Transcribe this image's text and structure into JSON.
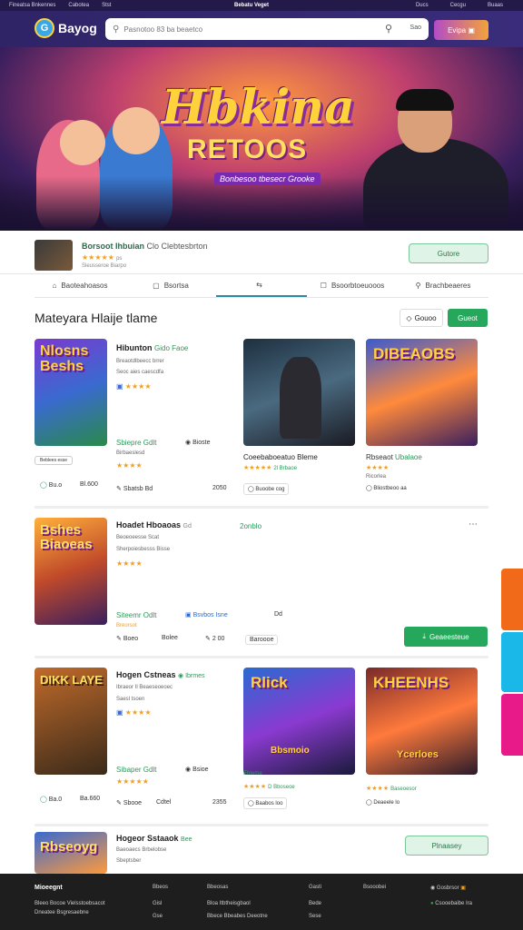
{
  "topbar": {
    "left1": "Fineatsa Bnkennes",
    "left2": "Cabotea",
    "left3": "Stst",
    "center": "Bebatu Veget",
    "r1": "Ducs",
    "r2": "Cecgu",
    "r3": "Buaas"
  },
  "header": {
    "logo": "Bayog",
    "search_placeholder": "Pasnotoo 83 ba beaetco",
    "search_value": "Sao",
    "button": "Evipa"
  },
  "hero": {
    "title": "Hbkina",
    "subtitle": "RETOOS",
    "tagline": "Bonbesoo tbesecr Grooke"
  },
  "featured": {
    "title": "Borsoot Ihbuian",
    "extra": "Clo Clebtesbrton",
    "rating": "★★★★★",
    "rating_tail": "ps",
    "desc": "Sleusseroe Biarpo",
    "button": "Gutore"
  },
  "tabs": [
    {
      "label": "Baoteahoasos",
      "icon": "⌂"
    },
    {
      "label": "Bsortsa",
      "icon": "▢"
    },
    {
      "label": "",
      "icon": "⇆"
    },
    {
      "label": "Bsoorbtoeuooos",
      "icon": "☐"
    },
    {
      "label": "Brachbeaeres",
      "icon": "⚲"
    }
  ],
  "section": {
    "title": "Mateyara Hlaije tlame",
    "filter": "Gouoo",
    "go": "Gueot"
  },
  "row1": {
    "title": "Hibunton",
    "tag": "Gido Faoe",
    "line1": "Breaotdlbeecc brrer",
    "line2": "Seoc aies caescdfa",
    "stars": "★★★★",
    "sub": "Sbiepre Gdlt",
    "sub_btn": "Bioste",
    "sub_line": "Birbaeslesd",
    "stars2": "★★★★",
    "badge": "Beblees esse",
    "m1": "Bu.o",
    "m2": "Bl.600",
    "m3": "Sbatsb Bd",
    "m4": "2050",
    "card1": "Nlosns Beshs",
    "card2_title": "Coeebaboeatuo Bleme",
    "card2_stars": "★★★★★",
    "card2_rate": "2l Brbaoe",
    "card2_btn": "Buoobe cog",
    "card3": "DIBEAOBS",
    "card3_title": "Rbseaot",
    "card3_tag": "Ubalaoe",
    "card3_stars": "★★★★",
    "card3_sub": "Ricorlea",
    "card3_btn": "Bliostbeoo aa"
  },
  "row2": {
    "title": "Hoadet Hboaoas",
    "tag": "Gd",
    "green": "2onblo",
    "line1": "Beoeoeesse Scat",
    "line2": "Sherpoiesbesss Bisse",
    "stars": "★★★★",
    "sub": "Siteemr Odlt",
    "sub2": "Bsvbos Isne",
    "sub3": "Dd",
    "sub4": "Breorsot",
    "m1": "Boeo",
    "m2": "Bolee",
    "m3": "2 00",
    "m4": "Baroooe",
    "card": "Bshes Biaoeas",
    "download": "Geaeesteue"
  },
  "row3": {
    "title": "Hogen Cstneas",
    "tag": "Ibrmes",
    "line1": "Ibraeor Il Beaeseoeoec",
    "line2": "Saesl tsoen",
    "stars": "★★★★",
    "sub": "Sibaper Gdlt",
    "sub_btn": "Bsioe",
    "stars2": "★★★★★",
    "m1": "Ba.0",
    "m2": "Ba.660",
    "m3": "Sbooe",
    "m4": "Cdtel",
    "m5": "2355",
    "card1": "DIKK LAYE",
    "card2": "Rlick",
    "card2_sub": "Bbsmoio",
    "card2_tag": "Ebteme",
    "card2_stars": "★★★★",
    "card2_rate": "D Bboseoe",
    "card2_btn": "Baabos loo",
    "card3": "KHEENHS",
    "card3_sub": "Ycerloes",
    "card3_stars": "★★★★",
    "card3_rate": "Baseoesor",
    "card3_btn": "Deaeele lo"
  },
  "row4": {
    "card": "Rbseoyg",
    "title": "Hogeor Sstaaok",
    "tag": "Bee",
    "line1": "Baeoaecs Brbelobse",
    "line2": "Sbeptsber",
    "button": "Plnaasey"
  },
  "footer": {
    "brand": "Mioeegnt",
    "brand_desc1": "Bleeo Bocoe Vielsstoebsacot",
    "brand_desc2": "Dneatee Bsgresaebne",
    "c1h": "Bbeos",
    "c1a": "Gisl",
    "c1b": "Gse",
    "c2h": "Bbeosas",
    "c2a": "Bloa Itbtheisgbaol",
    "c2b": "Bbece Bbeabes Deeotne",
    "c3h": "Gasti",
    "c3a": "Bede",
    "c3b": "Sese",
    "c4h": "Bsooobei",
    "c5h": "Gosbrsor",
    "c5b": "Csooebaibe Ira"
  }
}
